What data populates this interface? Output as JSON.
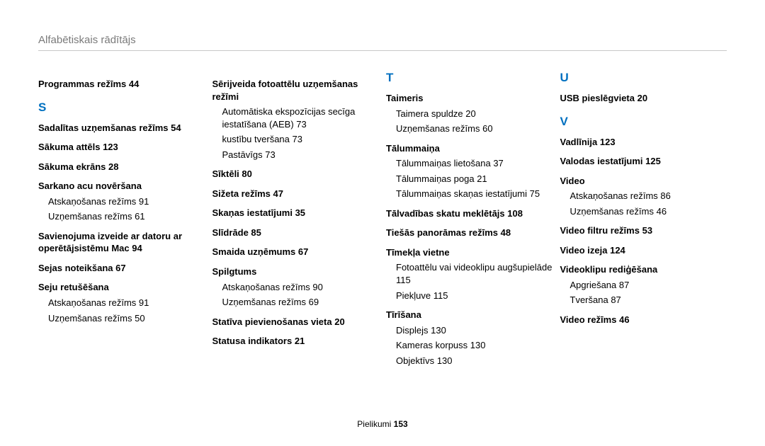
{
  "header": {
    "title": "Alfabētiskais rādītājs"
  },
  "footer": {
    "label": "Pielikumi",
    "page": "153"
  },
  "col1": {
    "e0": {
      "label": "Programmas režīms",
      "page": "44"
    },
    "letterS": "S",
    "e1": {
      "label": "Sadalītas uzņemšanas režīms",
      "page": "54"
    },
    "e2": {
      "label": "Sākuma attēls",
      "page": "123"
    },
    "e3": {
      "label": "Sākuma ekrāns",
      "page": "28"
    },
    "e4": {
      "label": "Sarkano acu novēršana"
    },
    "e4a": {
      "label": "Atskaņošanas režīms",
      "page": "91"
    },
    "e4b": {
      "label": "Uzņemšanas režīms",
      "page": "61"
    },
    "e5": {
      "label": "Savienojuma izveide ar datoru ar operētājsistēmu Mac",
      "page": "94"
    },
    "e6": {
      "label": "Sejas noteikšana",
      "page": "67"
    },
    "e7": {
      "label": "Seju retušēšana"
    },
    "e7a": {
      "label": "Atskaņošanas režīms",
      "page": "91"
    },
    "e7b": {
      "label": "Uzņemšanas režīms",
      "page": "50"
    }
  },
  "col2": {
    "e0": {
      "label": "Sērijveida fotoattēlu uzņemšanas režīmi"
    },
    "e0a": {
      "label": "Automātiska ekspozīcijas secīga iestatīšana (AEB)",
      "page": "73"
    },
    "e0b": {
      "label": "kustību tveršana",
      "page": "73"
    },
    "e0c": {
      "label": "Pastāvīgs",
      "page": "73"
    },
    "e1": {
      "label": "Sīktēli",
      "page": "80"
    },
    "e2": {
      "label": "Sižeta režīms",
      "page": "47"
    },
    "e3": {
      "label": "Skaņas iestatījumi",
      "page": "35"
    },
    "e4": {
      "label": "Slīdrāde",
      "page": "85"
    },
    "e5": {
      "label": "Smaida uzņēmums",
      "page": "67"
    },
    "e6": {
      "label": "Spilgtums"
    },
    "e6a": {
      "label": "Atskaņošanas režīms",
      "page": "90"
    },
    "e6b": {
      "label": "Uzņemšanas režīms",
      "page": "69"
    },
    "e7": {
      "label": "Statīva pievienošanas vieta",
      "page": "20"
    },
    "e8": {
      "label": "Statusa indikators",
      "page": "21"
    }
  },
  "col3": {
    "letterT": "T",
    "e0": {
      "label": "Taimeris"
    },
    "e0a": {
      "label": "Taimera spuldze",
      "page": "20"
    },
    "e0b": {
      "label": "Uzņemšanas režīms",
      "page": "60"
    },
    "e1": {
      "label": "Tālummaiņa"
    },
    "e1a": {
      "label": "Tālummaiņas lietošana",
      "page": "37"
    },
    "e1b": {
      "label": "Tālummaiņas poga",
      "page": "21"
    },
    "e1c": {
      "label": "Tālummaiņas skaņas iestatījumi",
      "page": "75"
    },
    "e2": {
      "label": "Tālvadības skatu meklētājs",
      "page": "108"
    },
    "e3": {
      "label": "Tiešās panorāmas režīms",
      "page": "48"
    },
    "e4": {
      "label": "Tīmekļa vietne"
    },
    "e4a": {
      "label": "Fotoattēlu vai videoklipu augšupielāde",
      "page": "115"
    },
    "e4b": {
      "label": "Piekļuve",
      "page": "115"
    },
    "e5": {
      "label": "Tīrīšana"
    },
    "e5a": {
      "label": "Displejs",
      "page": "130"
    },
    "e5b": {
      "label": "Kameras korpuss",
      "page": "130"
    },
    "e5c": {
      "label": "Objektīvs",
      "page": "130"
    }
  },
  "col4": {
    "letterU": "U",
    "e0": {
      "label": "USB pieslēgvieta",
      "page": "20"
    },
    "letterV": "V",
    "e1": {
      "label": "Vadlīnija",
      "page": "123"
    },
    "e2": {
      "label": "Valodas iestatījumi",
      "page": "125"
    },
    "e3": {
      "label": "Video"
    },
    "e3a": {
      "label": "Atskaņošanas režīms",
      "page": "86"
    },
    "e3b": {
      "label": "Uzņemšanas režīms",
      "page": "46"
    },
    "e4": {
      "label": "Video filtru režīms",
      "page": "53"
    },
    "e5": {
      "label": "Video izeja",
      "page": "124"
    },
    "e6": {
      "label": "Videoklipu rediģēšana"
    },
    "e6a": {
      "label": "Apgriešana",
      "page": "87"
    },
    "e6b": {
      "label": "Tveršana",
      "page": "87"
    },
    "e7": {
      "label": "Video režīms",
      "page": "46"
    }
  }
}
